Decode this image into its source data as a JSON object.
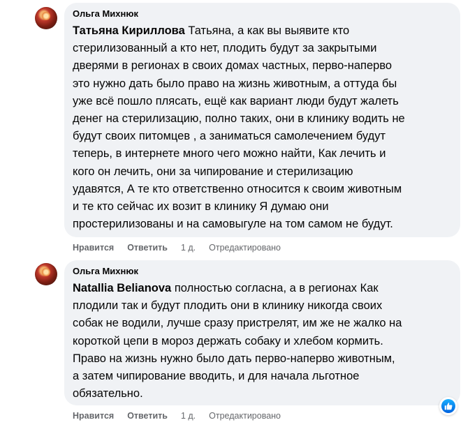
{
  "comments": [
    {
      "author": "Ольга Михнюк",
      "mention": "Татьяна Кириллова",
      "lines": [
        " Татьяна, а как вы выявите кто",
        "стерилизованный а кто нет, плодить будут за закрытыми",
        "дверями в регионах в своих домах частных, перво-наперво",
        "это нужно дать было право на жизнь животным, а оттуда бы",
        "уже всё пошло плясать, ещё как вариант люди будут жалеть",
        "денег на стерилизацию, полно таких, они в клинику водить не",
        "будут своих питомцев , а заниматься самолечением будут",
        "теперь, в интернете много чего можно найти, Как лечить и",
        "кого он лечить, они за чипирование и стерилизацию",
        "удавятся, А те кто ответственно относится к своим животным",
        "и те кто сейчас их возит в клинику Я думаю они",
        "простерилизованы и на самовыгуле на том самом не будут."
      ],
      "actions": {
        "like": "Нравится",
        "reply": "Ответить",
        "time": "1 д.",
        "edited": "Отредактировано"
      }
    },
    {
      "author": "Ольга Михнюк",
      "mention": "Natallia Belianova",
      "lines": [
        " полностью согласна, а в регионах Как",
        "плодили так и будут плодить они в клинику никогда своих",
        "собак не водили, лучше сразу пристрелят, им же не жалко на",
        "короткой цепи в мороз держать собаку и хлебом кормить.",
        "Право на жизнь нужно было дать перво-наперво животным,",
        "а затем чипирование вводить, и для начала льготное",
        "обязательно."
      ],
      "actions": {
        "like": "Нравится",
        "reply": "Ответить",
        "time": "1 д.",
        "edited": "Отредактировано"
      },
      "reaction": "like-icon"
    }
  ],
  "colors": {
    "bubble": "#f0f2f5",
    "meta": "#65676b",
    "like_blue": "#0866ff"
  }
}
